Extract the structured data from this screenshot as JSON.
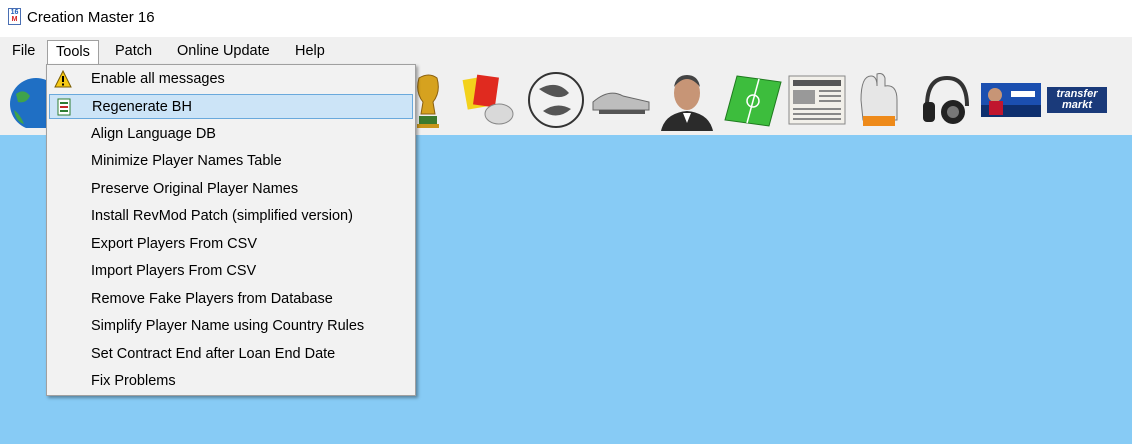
{
  "window": {
    "title": "Creation Master 16",
    "app_icon": {
      "top": "16",
      "bottom": "M"
    }
  },
  "menubar": {
    "items": [
      {
        "label": "File"
      },
      {
        "label": "Tools"
      },
      {
        "label": "Patch"
      },
      {
        "label": "Online Update"
      },
      {
        "label": "Help"
      }
    ],
    "active": "Tools"
  },
  "toolbar": {
    "icons": [
      "globe-icon",
      "world-cup-trophy-icon",
      "referee-cards-icon",
      "football-icon",
      "football-boots-icon",
      "manager-portrait-icon",
      "pitch-icon",
      "newspaper-icon",
      "goalkeeper-gloves-icon",
      "headphones-icon",
      "fifa-cover-icon",
      "transfermarkt-icon"
    ],
    "transfermarkt_text": {
      "line1": "transfer",
      "line2": "markt"
    }
  },
  "tools_menu": {
    "items": [
      {
        "label": "Enable all messages",
        "icon": "warning-icon"
      },
      {
        "label": "Regenerate BH",
        "icon": "regenerate-icon",
        "highlighted": true
      },
      {
        "label": "Align Language DB"
      },
      {
        "label": "Minimize Player Names Table"
      },
      {
        "label": "Preserve Original Player Names"
      },
      {
        "label": "Install RevMod Patch (simplified version)"
      },
      {
        "label": "Export Players From CSV"
      },
      {
        "label": "Import Players From CSV"
      },
      {
        "label": "Remove Fake Players from Database"
      },
      {
        "label": "Simplify Player Name using Country Rules"
      },
      {
        "label": "Set Contract End after Loan End Date"
      },
      {
        "label": "Fix Problems"
      }
    ]
  },
  "colors": {
    "client_background": "#87cbf5",
    "menu_highlight": "#cce4f7",
    "menu_highlight_border": "#6aa9dc"
  }
}
